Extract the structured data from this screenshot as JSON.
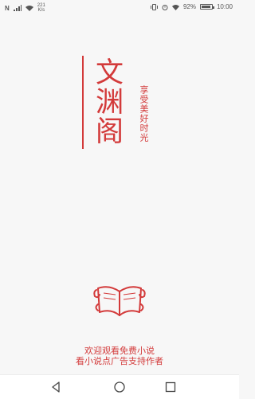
{
  "status_bar": {
    "left_badge": "N",
    "speed_value": "221",
    "speed_unit": "K/s",
    "battery": "92%",
    "time": "10:00",
    "battery_level": 0.92
  },
  "brand": {
    "title": "文渊阁",
    "slogan": "享受美好时光",
    "accent_color": "#d33a3a"
  },
  "welcome": {
    "line1": "欢迎观看免费小说",
    "line2": "看小说点广告支持作者"
  },
  "nav": {
    "back_icon": "back-triangle-icon",
    "home_icon": "home-circle-icon",
    "recent_icon": "recent-square-icon"
  }
}
